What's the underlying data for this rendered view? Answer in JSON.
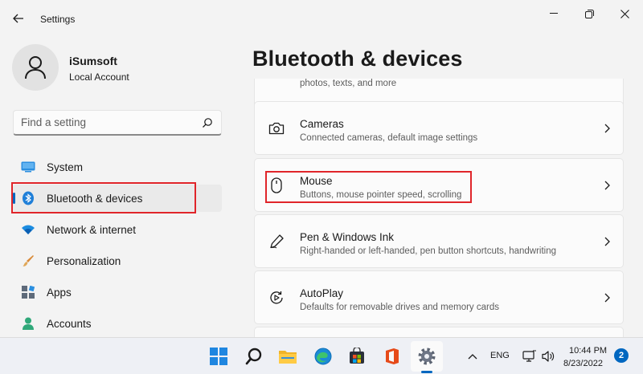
{
  "window": {
    "title": "Settings",
    "controls": [
      "minimize-icon",
      "restore-icon",
      "close-icon"
    ]
  },
  "profile": {
    "name": "iSumsoft",
    "account_type": "Local Account"
  },
  "search": {
    "placeholder": "Find a setting"
  },
  "sidebar": {
    "items": [
      {
        "label": "System",
        "icon": "system-icon"
      },
      {
        "label": "Bluetooth & devices",
        "icon": "bluetooth-icon",
        "selected": true
      },
      {
        "label": "Network & internet",
        "icon": "wifi-icon"
      },
      {
        "label": "Personalization",
        "icon": "brush-icon"
      },
      {
        "label": "Apps",
        "icon": "apps-icon"
      },
      {
        "label": "Accounts",
        "icon": "person-icon"
      }
    ]
  },
  "main": {
    "title": "Bluetooth & devices",
    "partial_text": "photos, texts, and more",
    "cards": [
      {
        "title": "Cameras",
        "subtitle": "Connected cameras, default image settings",
        "icon": "camera-icon"
      },
      {
        "title": "Mouse",
        "subtitle": "Buttons, mouse pointer speed, scrolling",
        "icon": "mouse-icon",
        "highlighted": true
      },
      {
        "title": "Pen & Windows Ink",
        "subtitle": "Right-handed or left-handed, pen button shortcuts, handwriting",
        "icon": "pen-icon"
      },
      {
        "title": "AutoPlay",
        "subtitle": "Defaults for removable drives and memory cards",
        "icon": "autoplay-icon"
      }
    ]
  },
  "taskbar": {
    "apps": [
      "start-icon",
      "search-icon",
      "file-explorer-icon",
      "edge-icon",
      "store-icon",
      "office-icon",
      "settings-icon"
    ],
    "tray": {
      "language": "ENG",
      "time": "10:44 PM",
      "date": "8/23/2022",
      "notifications": "2"
    }
  },
  "colors": {
    "accent": "#0067c0",
    "highlight_box": "#e0252a"
  }
}
